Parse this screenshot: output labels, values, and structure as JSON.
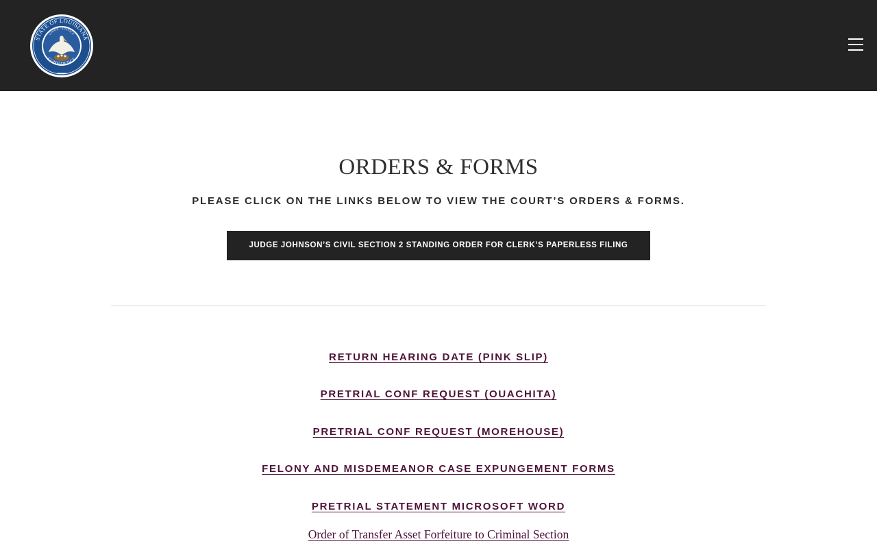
{
  "header": {
    "seal": {
      "icon": "louisiana-state-seal-icon",
      "top_text": "STATE OF LOUISIANA",
      "motto": "UNION · JUSTICE",
      "bottom_text": "CONFIDENCE",
      "colors": {
        "ring": "#1d4f8f",
        "outer": "#ffffff",
        "inner": "#2a5da0"
      }
    },
    "menu_icon": "hamburger-menu-icon",
    "background": "#232323"
  },
  "main": {
    "title": "ORDERS & FORMS",
    "subtitle": "PLEASE CLICK ON THE LINKS BELOW TO VIEW THE COURT’S ORDERS & FORMS.",
    "standing_order_button": "JUDGE JOHNSON’S CIVIL SECTION 2 STANDING ORDER FOR CLERK’S PAPERLESS FILING",
    "links": [
      "RETURN HEARING DATE (PINK SLIP)",
      "PRETRIAL CONF REQUEST (OUACHITA)",
      "PRETRIAL CONF REQUEST (MOREHOUSE)",
      "FELONY AND MISDEMEANOR CASE EXPUNGEMENT FORMS",
      "PRETRIAL STATEMENT MICROSOFT WORD",
      "Order of Transfer Asset Forfeiture to Criminal Section"
    ],
    "link_color": "#4d1338"
  }
}
